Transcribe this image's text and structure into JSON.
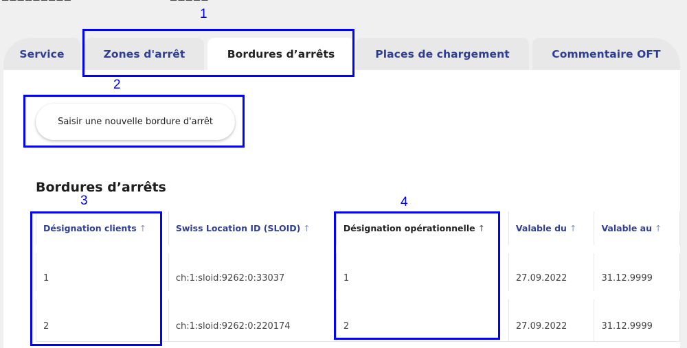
{
  "tabs": [
    {
      "label": "Service",
      "active": false
    },
    {
      "label": "Zones d'arrêt",
      "active": false
    },
    {
      "label": "Bordures d’arrêts",
      "active": true
    },
    {
      "label": "Places de chargement",
      "active": false
    },
    {
      "label": "Commentaire OFT",
      "active": false
    }
  ],
  "actions": {
    "new_button_label": "Saisir une nouvelle bordure d'arrêt"
  },
  "section": {
    "title": "Bordures d’arrêts"
  },
  "table": {
    "sort_icon": "arrow-up-icon",
    "sort_glyph": "↑",
    "columns": [
      {
        "label": "Désignation clients"
      },
      {
        "label": "Swiss Location ID (SLOID)"
      },
      {
        "label": "Désignation opérationnelle"
      },
      {
        "label": "Valable du"
      },
      {
        "label": "Valable au"
      }
    ],
    "rows": [
      [
        "1",
        "ch:1:sloid:9262:0:33037",
        "1",
        "27.09.2022",
        "31.12.9999"
      ],
      [
        "2",
        "ch:1:sloid:9262:0:220174",
        "2",
        "27.09.2022",
        "31.12.9999"
      ]
    ]
  },
  "annotations": [
    "1",
    "2",
    "3",
    "4"
  ],
  "colors": {
    "accent": "#2f3f97",
    "annotation": "#0000ff",
    "tab_inactive_bg": "#e8e8e8",
    "page_bg": "#f0f0f0"
  }
}
